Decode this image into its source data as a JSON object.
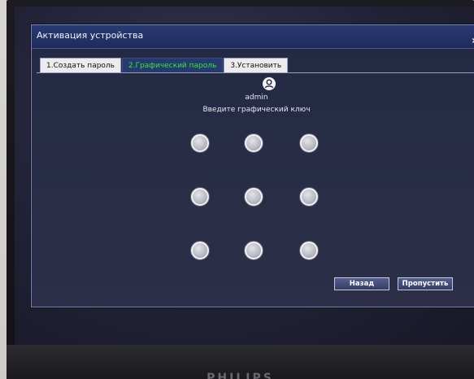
{
  "dialog": {
    "title": "Активация устройства",
    "close_label": "×"
  },
  "tabs": [
    {
      "label": "1.Создать пароль",
      "active": false
    },
    {
      "label": "2.Графический пароль",
      "active": true
    },
    {
      "label": "3.Установить",
      "active": false
    }
  ],
  "user": {
    "icon": "user-icon",
    "name": "admin"
  },
  "pattern": {
    "prompt": "Введите графический ключ",
    "rows": 3,
    "cols": 3
  },
  "buttons": {
    "back_label": "Назад",
    "skip_label": "Пропустить"
  },
  "monitor": {
    "brand": "PHILIPS"
  },
  "colors": {
    "active_tab_text": "#38e638",
    "titlebar": "#1e2c5c"
  }
}
